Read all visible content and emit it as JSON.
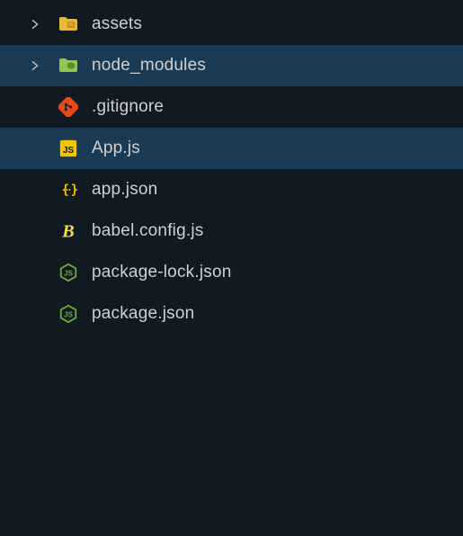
{
  "tree": {
    "items": [
      {
        "type": "folder",
        "name": "assets",
        "icon": "folder-assets",
        "expanded": false,
        "selected": false
      },
      {
        "type": "folder",
        "name": "node_modules",
        "icon": "folder-node",
        "expanded": false,
        "selected": true
      },
      {
        "type": "file",
        "name": ".gitignore",
        "icon": "git",
        "selected": false
      },
      {
        "type": "file",
        "name": "App.js",
        "icon": "js",
        "selected": true
      },
      {
        "type": "file",
        "name": "app.json",
        "icon": "json",
        "selected": false
      },
      {
        "type": "file",
        "name": "babel.config.js",
        "icon": "babel",
        "selected": false
      },
      {
        "type": "file",
        "name": "package-lock.json",
        "icon": "nodejs",
        "selected": false
      },
      {
        "type": "file",
        "name": "package.json",
        "icon": "nodejs",
        "selected": false
      }
    ]
  }
}
